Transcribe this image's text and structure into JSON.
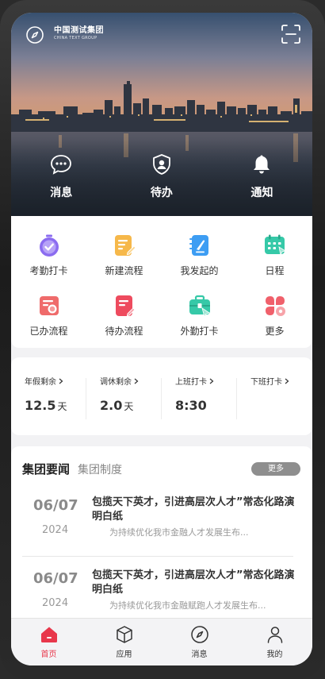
{
  "header": {
    "company_cn": "中国测试集团",
    "company_en": "CHINA TEXT GROUP"
  },
  "hero_actions": [
    {
      "label": "消息",
      "icon": "chat-bubble-icon"
    },
    {
      "label": "待办",
      "icon": "shield-user-icon"
    },
    {
      "label": "通知",
      "icon": "bell-icon"
    }
  ],
  "apps": [
    {
      "label": "考勤打卡",
      "icon": "stopwatch-check-icon",
      "color": "#8b6cf0"
    },
    {
      "label": "新建流程",
      "icon": "new-document-icon",
      "color": "#f6b84a"
    },
    {
      "label": "我发起的",
      "icon": "document-pen-icon",
      "color": "#3d9df3"
    },
    {
      "label": "日程",
      "icon": "calendar-icon",
      "color": "#36c9a8"
    },
    {
      "label": "已办流程",
      "icon": "done-document-icon",
      "color": "#ef6b6b"
    },
    {
      "label": "待办流程",
      "icon": "pending-document-icon",
      "color": "#ee4b5e"
    },
    {
      "label": "外勤打卡",
      "icon": "briefcase-icon",
      "color": "#36c9a8"
    },
    {
      "label": "更多",
      "icon": "more-petals-icon",
      "color": "#f0606b"
    }
  ],
  "stats": [
    {
      "label": "年假剩余",
      "value": "12.5",
      "unit": "天"
    },
    {
      "label": "调休剩余",
      "value": "2.0",
      "unit": "天"
    },
    {
      "label": "上班打卡",
      "value": "8:30",
      "unit": ""
    },
    {
      "label": "下班打卡",
      "value": "",
      "unit": ""
    }
  ],
  "news": {
    "tab_active": "集团要闻",
    "tab_other": "集团制度",
    "more_label": "更多",
    "items": [
      {
        "date": "06/07",
        "year": "2024",
        "title": "包揽天下英才，引进高层次人才”常态化路演明白纸",
        "desc": "为持续优化我市金融人才发展生布..."
      },
      {
        "date": "06/07",
        "year": "2024",
        "title": "包揽天下英才，引进高层次人才”常态化路演明白纸",
        "desc": "为持续优化我市金融赋跑人才发展生布..."
      }
    ]
  },
  "tabbar": [
    {
      "label": "首页",
      "icon": "home-icon",
      "active": true
    },
    {
      "label": "应用",
      "icon": "cube-icon",
      "active": false
    },
    {
      "label": "消息",
      "icon": "compass-icon",
      "active": false
    },
    {
      "label": "我的",
      "icon": "user-icon",
      "active": false
    }
  ],
  "colors": {
    "accent": "#e8374b",
    "more_button": "#8e8e8e"
  }
}
